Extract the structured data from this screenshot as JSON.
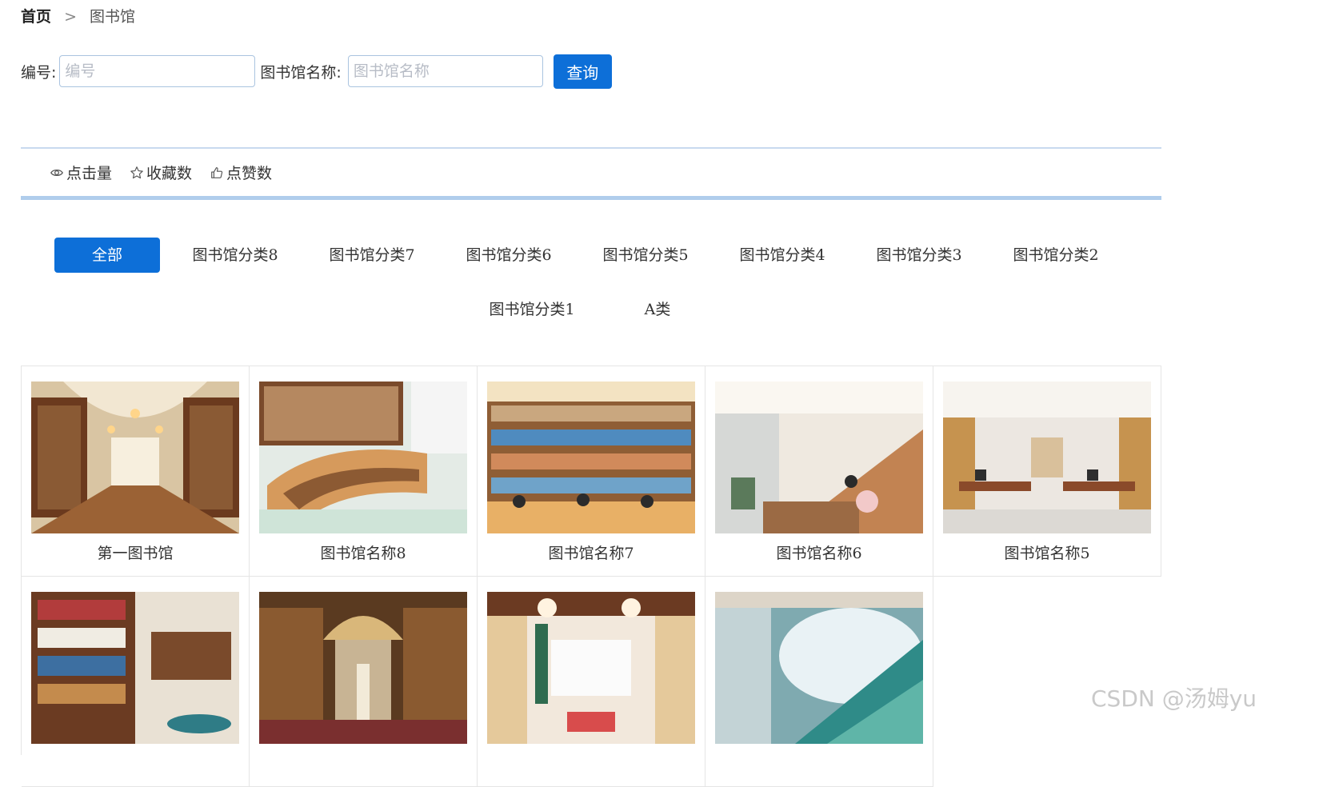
{
  "breadcrumb": {
    "home": "首页",
    "separator": ">",
    "current": "图书馆"
  },
  "search": {
    "id_label": "编号:",
    "id_placeholder": "编号",
    "id_value": "",
    "name_label": "图书馆名称:",
    "name_placeholder": "图书馆名称",
    "name_value": "",
    "query_button": "查询"
  },
  "sort": {
    "items": [
      {
        "label": "点击量",
        "icon": "eye-icon"
      },
      {
        "label": "收藏数",
        "icon": "star-icon"
      },
      {
        "label": "点赞数",
        "icon": "thumbs-up-icon"
      }
    ]
  },
  "categories": {
    "items": [
      "全部",
      "图书馆分类8",
      "图书馆分类7",
      "图书馆分类6",
      "图书馆分类5",
      "图书馆分类4",
      "图书馆分类3",
      "图书馆分类2",
      "图书馆分类1",
      "A类"
    ],
    "active": "全部"
  },
  "cards": [
    {
      "name": "第一图书馆"
    },
    {
      "name": "图书馆名称8"
    },
    {
      "name": "图书馆名称7"
    },
    {
      "name": "图书馆名称6"
    },
    {
      "name": "图书馆名称5"
    },
    {
      "name": ""
    },
    {
      "name": ""
    },
    {
      "name": ""
    },
    {
      "name": ""
    }
  ],
  "watermark": "CSDN @汤姆yu",
  "colors": {
    "primary": "#0d6fd8",
    "border_accent": "#b0cdec"
  }
}
